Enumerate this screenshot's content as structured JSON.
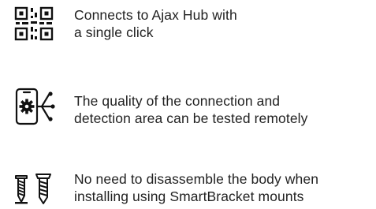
{
  "features": [
    {
      "icon": "qr-code-icon",
      "line1": "Connects to Ajax Hub with",
      "line2": "a single click"
    },
    {
      "icon": "phone-gear-signal-icon",
      "line1": "The quality of the connection and",
      "line2": "detection area can be tested remotely"
    },
    {
      "icon": "screws-icon",
      "line1": "No need to disassemble the body when",
      "line2": "installing using SmartBracket mounts"
    }
  ],
  "colors": {
    "text": "#222222",
    "icon": "#111111"
  }
}
